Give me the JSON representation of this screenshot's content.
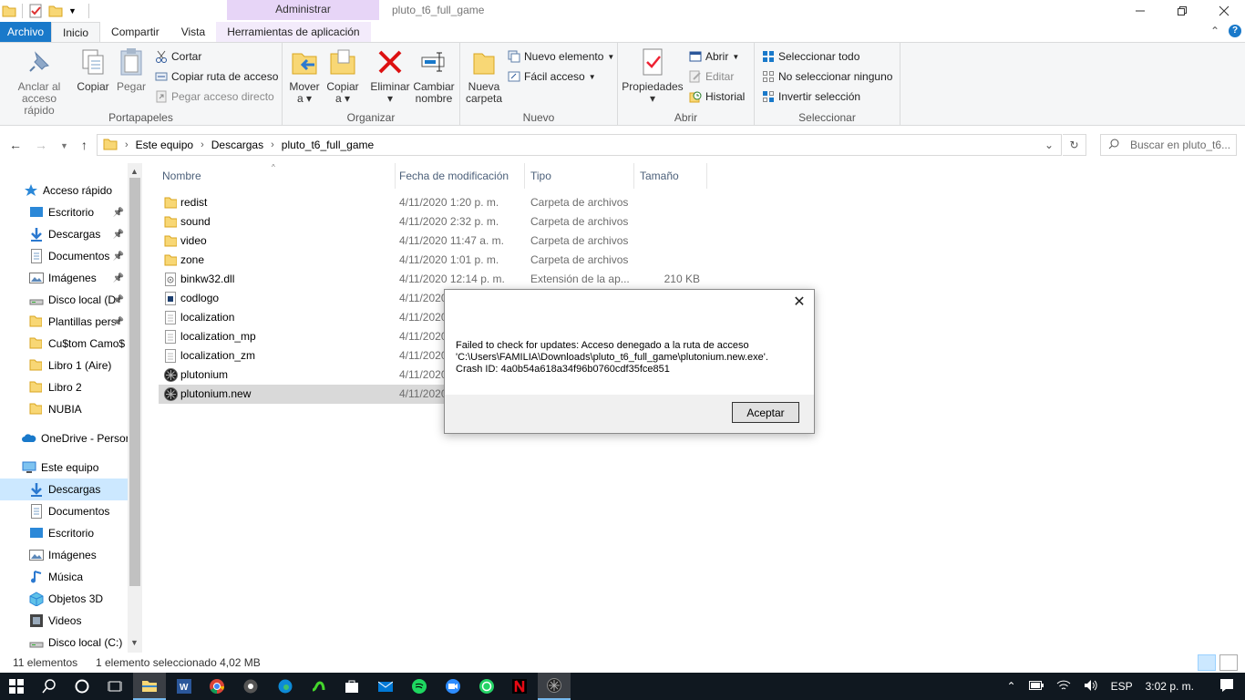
{
  "window": {
    "title": "pluto_t6_full_game",
    "context_header": "Administrar"
  },
  "tabs": {
    "file": "Archivo",
    "home": "Inicio",
    "share": "Compartir",
    "view": "Vista",
    "app_tools": "Herramientas de aplicación"
  },
  "ribbon": {
    "clipboard": {
      "label": "Portapapeles",
      "pin": "Anclar al acceso rápido",
      "copy": "Copiar",
      "paste": "Pegar",
      "cut": "Cortar",
      "copy_path": "Copiar ruta de acceso",
      "paste_shortcut": "Pegar acceso directo"
    },
    "organize": {
      "label": "Organizar",
      "move_to": "Mover a",
      "copy_to": "Copiar a",
      "delete": "Eliminar",
      "rename": "Cambiar nombre"
    },
    "new": {
      "label": "Nuevo",
      "new_folder": "Nueva carpeta",
      "new_item": "Nuevo elemento",
      "easy_access": "Fácil acceso"
    },
    "open": {
      "label": "Abrir",
      "properties": "Propiedades",
      "open": "Abrir",
      "edit": "Editar",
      "history": "Historial"
    },
    "select": {
      "label": "Seleccionar",
      "select_all": "Seleccionar todo",
      "select_none": "No seleccionar ninguno",
      "invert": "Invertir selección"
    }
  },
  "address": {
    "crumbs": [
      "Este equipo",
      "Descargas",
      "pluto_t6_full_game"
    ],
    "search_placeholder": "Buscar en pluto_t6..."
  },
  "nav": {
    "quick_access": "Acceso rápido",
    "items": [
      {
        "label": "Escritorio",
        "icon": "desktop-icon",
        "pinned": true
      },
      {
        "label": "Descargas",
        "icon": "download-icon",
        "pinned": true
      },
      {
        "label": "Documentos",
        "icon": "documents-icon",
        "pinned": true
      },
      {
        "label": "Imágenes",
        "icon": "pictures-icon",
        "pinned": true
      },
      {
        "label": "Disco local (D",
        "icon": "drive-icon",
        "pinned": true
      },
      {
        "label": "Plantillas pers",
        "icon": "folder-icon",
        "pinned": true
      },
      {
        "label": "Cu$tom Camo$",
        "icon": "folder-icon",
        "pinned": false
      },
      {
        "label": "Libro 1 (Aire)",
        "icon": "folder-icon",
        "pinned": false
      },
      {
        "label": "Libro 2",
        "icon": "folder-icon",
        "pinned": false
      },
      {
        "label": "NUBIA",
        "icon": "folder-icon",
        "pinned": false
      }
    ],
    "onedrive": "OneDrive - Persor",
    "this_pc": "Este equipo",
    "pc_items": [
      {
        "label": "Descargas",
        "icon": "download-icon",
        "selected": true
      },
      {
        "label": "Documentos",
        "icon": "documents-icon",
        "selected": false
      },
      {
        "label": "Escritorio",
        "icon": "desktop-icon",
        "selected": false
      },
      {
        "label": "Imágenes",
        "icon": "pictures-icon",
        "selected": false
      },
      {
        "label": "Música",
        "icon": "music-icon",
        "selected": false
      },
      {
        "label": "Objetos 3D",
        "icon": "3d-objects-icon",
        "selected": false
      },
      {
        "label": "Videos",
        "icon": "videos-icon",
        "selected": false
      },
      {
        "label": "Disco local (C:)",
        "icon": "drive-icon",
        "selected": false
      }
    ]
  },
  "columns": {
    "name": "Nombre",
    "date": "Fecha de modificación",
    "type": "Tipo",
    "size": "Tamaño"
  },
  "files": [
    {
      "name": "redist",
      "date": "4/11/2020 1:20 p. m.",
      "type": "Carpeta de archivos",
      "size": "",
      "icon": "folder-icon"
    },
    {
      "name": "sound",
      "date": "4/11/2020 2:32 p. m.",
      "type": "Carpeta de archivos",
      "size": "",
      "icon": "folder-icon"
    },
    {
      "name": "video",
      "date": "4/11/2020 11:47 a. m.",
      "type": "Carpeta de archivos",
      "size": "",
      "icon": "folder-icon"
    },
    {
      "name": "zone",
      "date": "4/11/2020 1:01 p. m.",
      "type": "Carpeta de archivos",
      "size": "",
      "icon": "folder-icon"
    },
    {
      "name": "binkw32.dll",
      "date": "4/11/2020 12:14 p. m.",
      "type": "Extensión de la ap...",
      "size": "210 KB",
      "icon": "dll-icon"
    },
    {
      "name": "codlogo",
      "date": "4/11/2020",
      "type": "",
      "size": "",
      "icon": "image-file-icon"
    },
    {
      "name": "localization",
      "date": "4/11/2020",
      "type": "",
      "size": "",
      "icon": "text-file-icon"
    },
    {
      "name": "localization_mp",
      "date": "4/11/2020",
      "type": "",
      "size": "",
      "icon": "text-file-icon"
    },
    {
      "name": "localization_zm",
      "date": "4/11/2020",
      "type": "",
      "size": "",
      "icon": "text-file-icon"
    },
    {
      "name": "plutonium",
      "date": "4/11/2020",
      "type": "",
      "size": "",
      "icon": "plutonium-icon"
    },
    {
      "name": "plutonium.new",
      "date": "4/11/2020",
      "type": "",
      "size": "",
      "icon": "plutonium-icon",
      "selected": true
    }
  ],
  "status": {
    "count": "11 elementos",
    "selection": "1 elemento seleccionado  4,02 MB"
  },
  "dialog": {
    "line1": "Failed to check for updates: Acceso denegado a la ruta de acceso",
    "line2": "'C:\\Users\\FAMILIA\\Downloads\\pluto_t6_full_game\\plutonium.new.exe'.",
    "line3": "Crash ID: 4a0b54a618a34f96b0760cdf35fce851",
    "ok": "Aceptar"
  },
  "taskbar": {
    "language": "ESP",
    "time": "3:02 p. m."
  },
  "colors": {
    "accent": "#1979ca",
    "selection": "#cce8ff",
    "context_tab": "#e7d5f7",
    "taskbar": "#101820"
  }
}
